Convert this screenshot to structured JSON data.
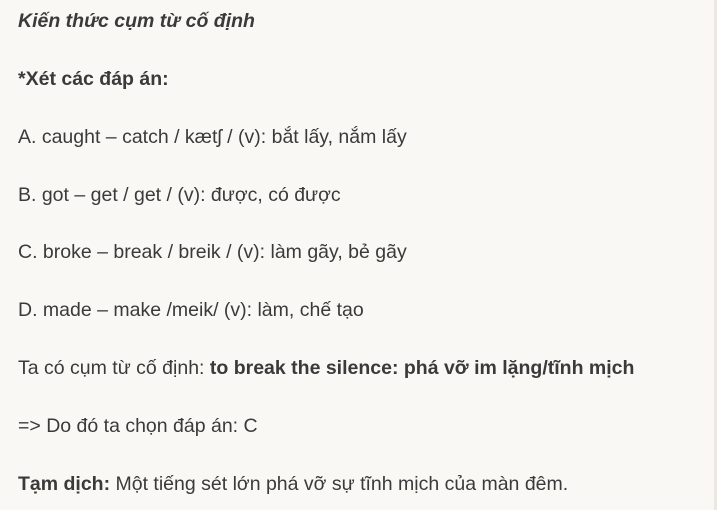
{
  "heading": "Kiến thức cụm từ cố định",
  "options_heading": "*Xét các đáp án:",
  "options": [
    "A. caught – catch / kætʃ / (v): bắt lấy, nắm lấy",
    "B. got – get / get / (v): được, có được",
    "C. broke – break / breik / (v): làm gãy, bẻ gãy",
    "D. made – make /meik/ (v): làm, chế tạo"
  ],
  "fixed_phrase": {
    "intro": "Ta có cụm từ cố định: ",
    "phrase": "to break the silence: phá vỡ im lặng/tĩnh mịch"
  },
  "conclusion": "=> Do đó ta chọn đáp án: C",
  "translation": {
    "label": "Tạm dịch:",
    "text": " Một tiếng sét lớn phá vỡ sự tĩnh mịch của màn đêm."
  }
}
